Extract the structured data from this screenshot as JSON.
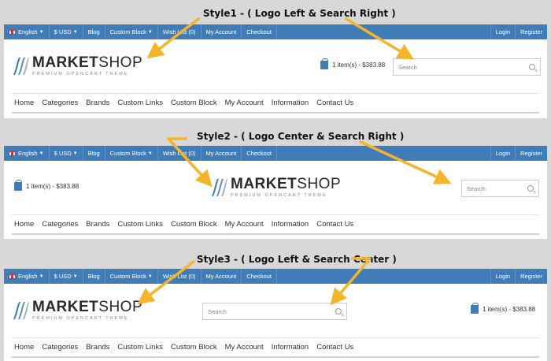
{
  "annotations": {
    "style1": "Style1 - ( Logo Left & Search Right )",
    "style2": "Style2 - ( Logo Center & Search Right )",
    "style3": "Style3 - ( Logo Left & Search Center )"
  },
  "topbar": {
    "language": "English",
    "currency": "$ USD",
    "blog": "Blog",
    "custom_block": "Custom Block",
    "wishlist": "Wish List (0)",
    "my_account": "My Account",
    "checkout": "Checkout",
    "login": "Login",
    "register": "Register"
  },
  "logo": {
    "main_bold": "MARKET",
    "main_light": "SHOP",
    "tagline": "PREMIUM OPENCART THEME"
  },
  "cart": {
    "summary": "1 item(s) - $383.88"
  },
  "search": {
    "placeholder": "Search"
  },
  "nav": {
    "items": [
      "Home",
      "Categories",
      "Brands",
      "Custom Links",
      "Custom Block",
      "My Account",
      "Information",
      "Contact Us"
    ]
  },
  "colors": {
    "topbar": "#3f7cb8",
    "arrow": "#f2b52c"
  }
}
